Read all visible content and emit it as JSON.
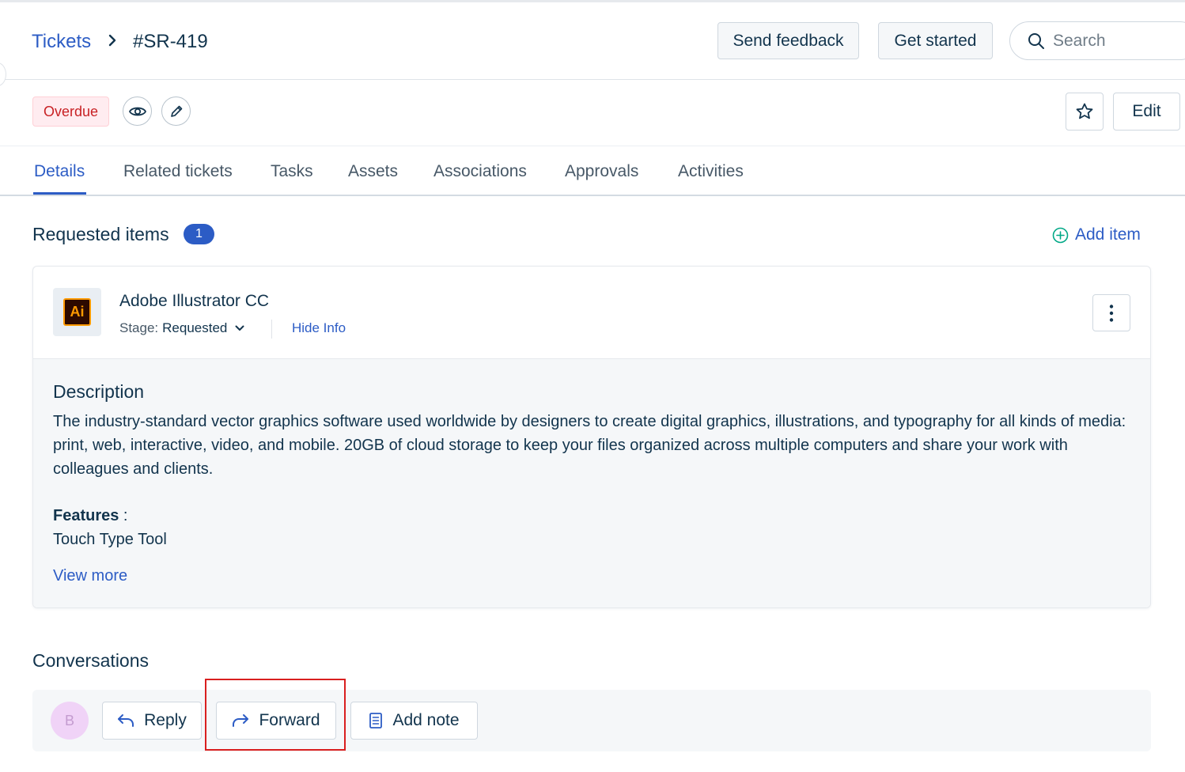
{
  "header": {
    "breadcrumb_root": "Tickets",
    "breadcrumb_current": "#SR-419",
    "send_feedback": "Send feedback",
    "get_started": "Get started",
    "search_placeholder": "Search"
  },
  "status": {
    "badge": "Overdue",
    "badge_color": "#c82124",
    "edit_label": "Edit"
  },
  "tabs": [
    "Details",
    "Related tickets",
    "Tasks",
    "Assets",
    "Associations",
    "Approvals",
    "Activities"
  ],
  "active_tab": "Details",
  "requested_items": {
    "title": "Requested items",
    "count": "1",
    "add_label": "Add item",
    "item": {
      "logo_text": "Ai",
      "name": "Adobe Illustrator CC",
      "stage_label": "Stage:",
      "stage_value": "Requested",
      "hide_info": "Hide Info",
      "description_title": "Description",
      "description": "The industry-standard vector graphics software used worldwide by designers to create digital graphics, illustrations, and typography for all kinds of media: print, web, interactive, video, and mobile. 20GB of cloud storage to keep your files organized across multiple computers and share your work with colleagues and clients.",
      "features_label": "Features",
      "features_sep": " :",
      "features_value": "Touch Type Tool",
      "view_more": "View more"
    }
  },
  "conversations": {
    "title": "Conversations",
    "avatar_initial": "B",
    "reply": "Reply",
    "forward": "Forward",
    "add_note": "Add note"
  },
  "colors": {
    "accent": "#2c5cc5",
    "text": "#12344d",
    "add_icon": "#00a886",
    "highlight": "#d91f1f"
  }
}
